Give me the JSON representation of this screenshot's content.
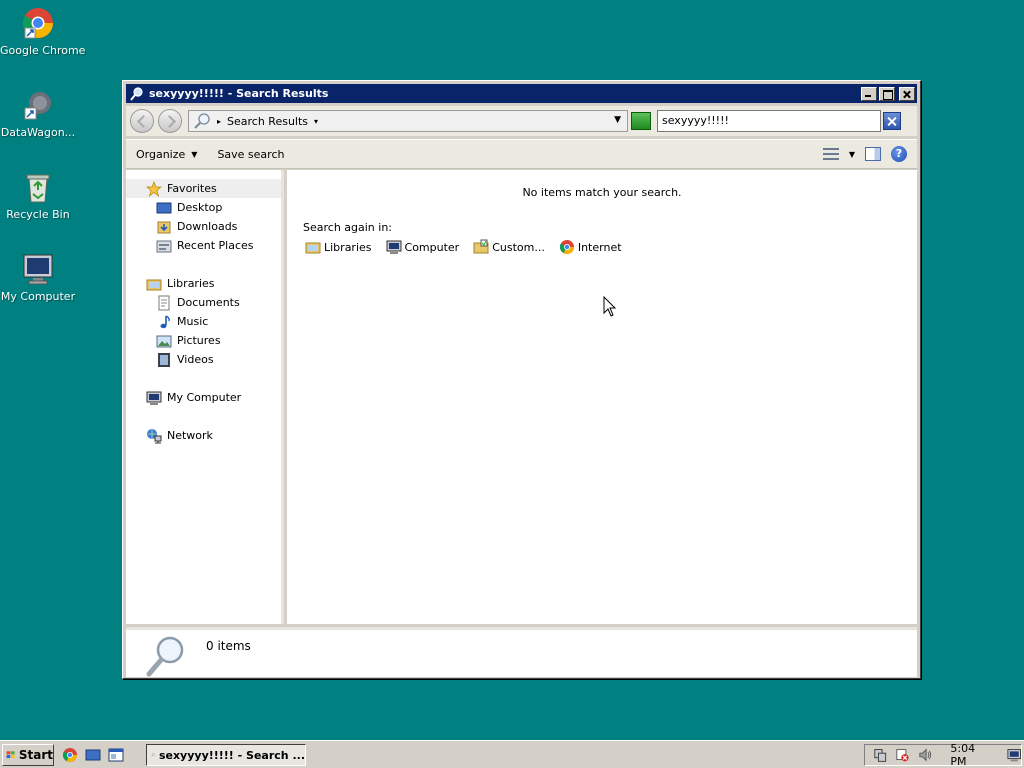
{
  "desktop": {
    "icons": [
      {
        "label": "Google Chrome"
      },
      {
        "label": "DataWagon..."
      },
      {
        "label": "Recycle Bin"
      },
      {
        "label": "My Computer"
      }
    ]
  },
  "window": {
    "title": "sexyyyy!!!!! - Search Results",
    "address": {
      "location": "Search Results"
    },
    "search": {
      "value": "sexyyyy!!!!!"
    },
    "command_bar": {
      "organize_label": "Organize",
      "save_search_label": "Save search"
    },
    "nav": {
      "favorites": "Favorites",
      "desktop": "Desktop",
      "downloads": "Downloads",
      "recent_places": "Recent Places",
      "libraries": "Libraries",
      "documents": "Documents",
      "music": "Music",
      "pictures": "Pictures",
      "videos": "Videos",
      "my_computer": "My Computer",
      "network": "Network"
    },
    "content": {
      "no_items": "No items match your search.",
      "search_again_in": "Search again in:",
      "locations": [
        {
          "label": "Libraries"
        },
        {
          "label": "Computer"
        },
        {
          "label": "Custom..."
        },
        {
          "label": "Internet"
        }
      ]
    },
    "details": {
      "count_text": "0 items"
    }
  },
  "taskbar": {
    "start_label": "Start",
    "task_label": "sexyyyy!!!!! - Search ...",
    "clock": "5:04 PM"
  },
  "colors": {
    "desktop": "#008080",
    "titlebar": "#0a246a",
    "chrome": "#d4d0c8"
  }
}
